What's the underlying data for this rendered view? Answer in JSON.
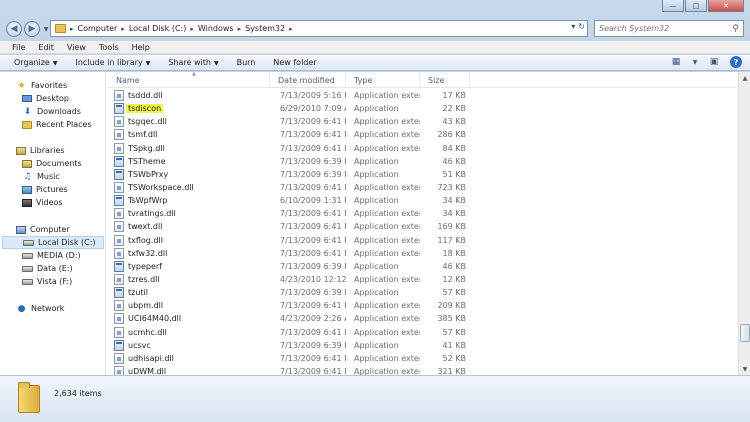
{
  "address": {
    "crumbs": [
      "Computer",
      "Local Disk (C:)",
      "Windows",
      "System32"
    ]
  },
  "search": {
    "placeholder": "Search System32"
  },
  "menubar": {
    "items": [
      "File",
      "Edit",
      "View",
      "Tools",
      "Help"
    ]
  },
  "commandbar": {
    "organize": "Organize",
    "include_in_library": "Include in library",
    "share_with": "Share with",
    "burn": "Burn",
    "new_folder": "New folder"
  },
  "navpane": {
    "favorites": {
      "label": "Favorites",
      "items": [
        "Desktop",
        "Downloads",
        "Recent Places"
      ]
    },
    "libraries": {
      "label": "Libraries",
      "items": [
        "Documents",
        "Music",
        "Pictures",
        "Videos"
      ]
    },
    "computer": {
      "label": "Computer",
      "items": [
        "Local Disk (C:)",
        "MEDIA (D:)",
        "Data (E:)",
        "Vista (F:)"
      ]
    },
    "network": {
      "label": "Network"
    }
  },
  "columns": {
    "name": "Name",
    "date": "Date modified",
    "type": "Type",
    "size": "Size"
  },
  "files": [
    {
      "name": "tsddd.dll",
      "date": "7/13/2009 5:16 PM",
      "type": "Application extens...",
      "size": "17 KB",
      "kind": "dll"
    },
    {
      "name": "tsdiscon",
      "date": "6/29/2010 7:09 AM",
      "type": "Application",
      "size": "22 KB",
      "kind": "exe",
      "highlight": true
    },
    {
      "name": "tsgqec.dll",
      "date": "7/13/2009 6:41 PM",
      "type": "Application extens...",
      "size": "43 KB",
      "kind": "dll"
    },
    {
      "name": "tsmf.dll",
      "date": "7/13/2009 6:41 PM",
      "type": "Application extens...",
      "size": "286 KB",
      "kind": "dll"
    },
    {
      "name": "TSpkg.dll",
      "date": "7/13/2009 6:41 PM",
      "type": "Application extens...",
      "size": "84 KB",
      "kind": "dll"
    },
    {
      "name": "TSTheme",
      "date": "7/13/2009 6:39 PM",
      "type": "Application",
      "size": "46 KB",
      "kind": "exe"
    },
    {
      "name": "TSWbPrxy",
      "date": "7/13/2009 6:39 PM",
      "type": "Application",
      "size": "51 KB",
      "kind": "exe"
    },
    {
      "name": "TSWorkspace.dll",
      "date": "7/13/2009 6:41 PM",
      "type": "Application extens...",
      "size": "723 KB",
      "kind": "dll"
    },
    {
      "name": "TsWpfWrp",
      "date": "6/10/2009 1:31 PM",
      "type": "Application",
      "size": "34 KB",
      "kind": "exe"
    },
    {
      "name": "tvratings.dll",
      "date": "7/13/2009 6:41 PM",
      "type": "Application extens...",
      "size": "34 KB",
      "kind": "dll"
    },
    {
      "name": "twext.dll",
      "date": "7/13/2009 6:41 PM",
      "type": "Application extens...",
      "size": "169 KB",
      "kind": "dll"
    },
    {
      "name": "txflog.dll",
      "date": "7/13/2009 6:41 PM",
      "type": "Application extens...",
      "size": "117 KB",
      "kind": "dll"
    },
    {
      "name": "txfw32.dll",
      "date": "7/13/2009 6:41 PM",
      "type": "Application extens...",
      "size": "18 KB",
      "kind": "dll"
    },
    {
      "name": "typeperf",
      "date": "7/13/2009 6:39 PM",
      "type": "Application",
      "size": "46 KB",
      "kind": "exe"
    },
    {
      "name": "tzres.dll",
      "date": "4/23/2010 12:12 AM",
      "type": "Application extens...",
      "size": "12 KB",
      "kind": "dll"
    },
    {
      "name": "tzutil",
      "date": "7/13/2009 6:39 PM",
      "type": "Application",
      "size": "57 KB",
      "kind": "exe"
    },
    {
      "name": "ubpm.dll",
      "date": "7/13/2009 6:41 PM",
      "type": "Application extens...",
      "size": "209 KB",
      "kind": "dll"
    },
    {
      "name": "UCI64M40.dll",
      "date": "4/23/2009 2:26 AM",
      "type": "Application extens...",
      "size": "385 KB",
      "kind": "dll"
    },
    {
      "name": "ucmhc.dll",
      "date": "7/13/2009 6:41 PM",
      "type": "Application extens...",
      "size": "57 KB",
      "kind": "dll"
    },
    {
      "name": "ucsvc",
      "date": "7/13/2009 6:39 PM",
      "type": "Application",
      "size": "41 KB",
      "kind": "exe"
    },
    {
      "name": "udhisapi.dll",
      "date": "7/13/2009 6:41 PM",
      "type": "Application extens...",
      "size": "52 KB",
      "kind": "dll"
    },
    {
      "name": "uDWM.dll",
      "date": "7/13/2009 6:41 PM",
      "type": "Application extens...",
      "size": "321 KB",
      "kind": "dll"
    }
  ],
  "details": {
    "item_count": "2,634 items"
  },
  "colors": {
    "highlight": "#f3f548",
    "selection": "#dceaf8",
    "chrome": "#b9cde0"
  }
}
